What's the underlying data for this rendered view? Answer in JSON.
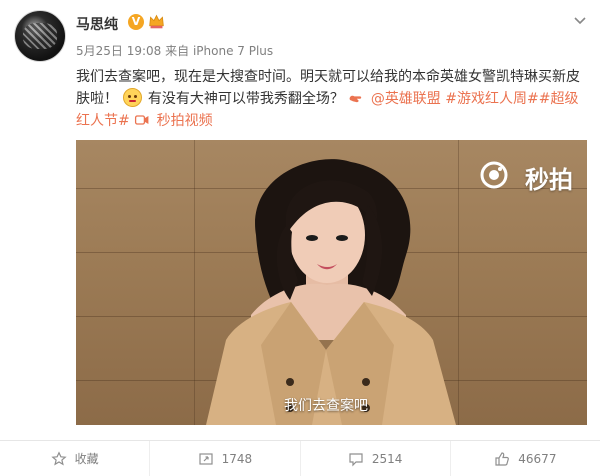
{
  "post": {
    "author": "马思纯",
    "verified_badge": "V",
    "time": "5月25日 19:08",
    "source": "来自 iPhone 7 Plus",
    "text_part1": "我们去查案吧，现在是大搜查时间。明天就可以给我的本命英雄女警凯特琳买新皮肤啦！",
    "text_part2": "有没有大神可以带我秀翻全场？",
    "mention": "@英雄联盟",
    "hashtags": "#游戏红人周##超级红人节#",
    "video_link": "秒拍视频"
  },
  "video": {
    "watermark": "秒拍",
    "subtitle": "我们去查案吧"
  },
  "actions": {
    "favorite": "收藏",
    "repost_count": "1748",
    "comment_count": "2514",
    "like_count": "46677"
  },
  "colors": {
    "accent": "#eb7350",
    "meta": "#808080",
    "verified": "#f5a623"
  },
  "icons": {
    "favorite": "star-icon",
    "repost": "repost-icon",
    "comment": "comment-icon",
    "like": "thumbs-up-icon",
    "menu": "chevron-down-icon"
  }
}
